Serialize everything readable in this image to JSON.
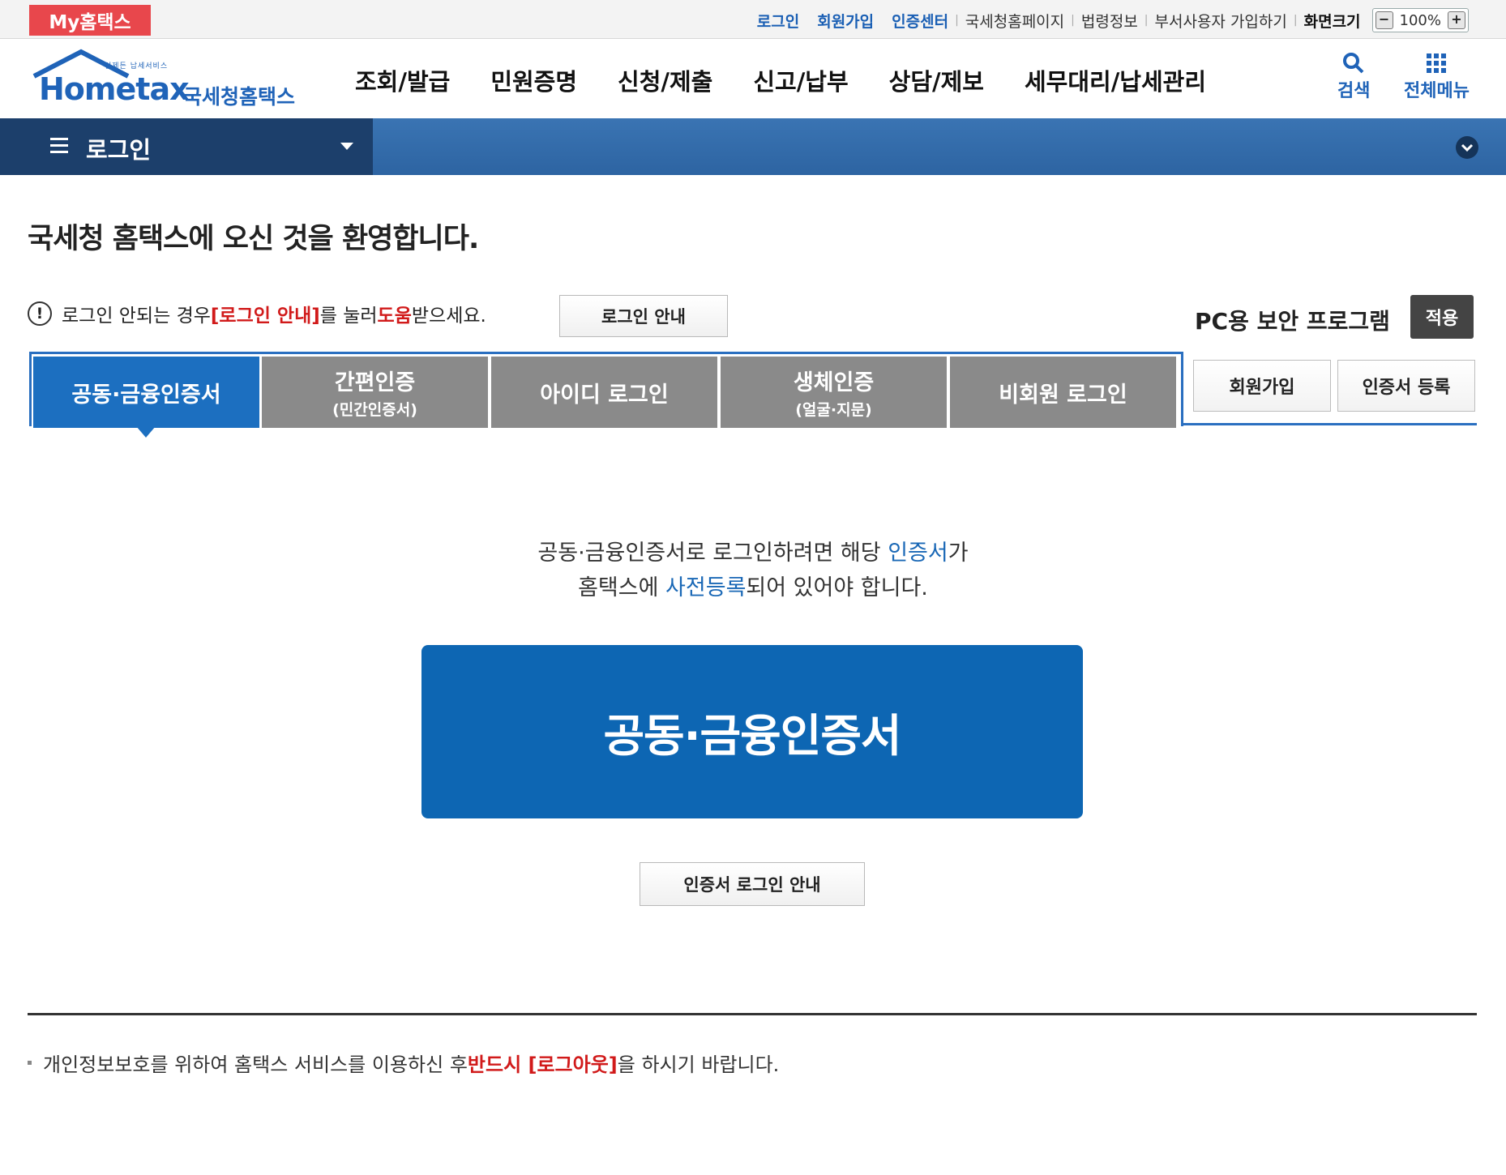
{
  "topbar": {
    "my_badge": "My홈택스",
    "links_blue": [
      "로그인",
      "회원가입",
      "인증센터"
    ],
    "links_plain": [
      "국세청홈페이지",
      "법령정보",
      "부서사용자 가입하기"
    ],
    "size_label": "화면크기",
    "zoom_minus": "−",
    "zoom_value": "100%",
    "zoom_plus": "+"
  },
  "header": {
    "logo_small": "언제든 납세서비스",
    "logo_main": "Hometax",
    "logo_kr": "국세청홈택스",
    "nav": [
      "조회/발급",
      "민원증명",
      "신청/제출",
      "신고/납부",
      "상담/제보",
      "세무대리/납세관리"
    ],
    "search_label": "검색",
    "all_menu_label": "전체메뉴"
  },
  "bluebar": {
    "title": "로그인"
  },
  "welcome": "국세청 홈택스에 오신 것을 환영합니다.",
  "help": {
    "icon": "!",
    "t1": "로그인 안되는 경우 ",
    "t2": "[로그인 안내]",
    "t3": "를 눌러 ",
    "t4": "도움",
    "t5": "받으세요.",
    "button": "로그인 안내"
  },
  "security": {
    "label": "PC용 보안 프로그램",
    "apply": "적용"
  },
  "tabs": [
    {
      "main": "공동·금융인증서",
      "sub": ""
    },
    {
      "main": "간편인증",
      "sub": "(민간인증서)"
    },
    {
      "main": "아이디 로그인",
      "sub": ""
    },
    {
      "main": "생체인증",
      "sub": "(얼굴·지문)"
    },
    {
      "main": "비회원 로그인",
      "sub": ""
    }
  ],
  "side_buttons": {
    "join": "회원가입",
    "cert_register": "인증서 등록"
  },
  "content": {
    "l1a": "공동·금융인증서로 로그인하려면 해당 ",
    "l1b": "인증서",
    "l1c": "가",
    "l2a": "홈택스에 ",
    "l2b": "사전등록",
    "l2c": "되어 있어야 합니다.",
    "big_button": "공동·금융인증서",
    "guide_button": "인증서 로그인 안내"
  },
  "footer": {
    "f1": "개인정보보호를 위하여 홈택스 서비스를 이용하신 후 ",
    "f2": "반드시 [로그아웃]",
    "f3": "을 하시기 바랍니다."
  },
  "colors": {
    "accent_blue": "#0d66b3",
    "badge_red": "#e8474c",
    "warn_red": "#d11a1a"
  }
}
